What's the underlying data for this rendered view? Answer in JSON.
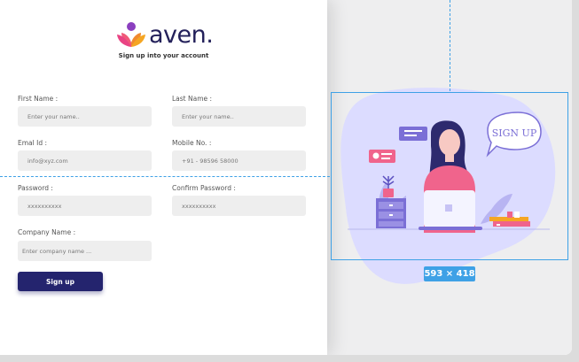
{
  "brand": {
    "name": "aven.",
    "tagline": "Sign up into your account"
  },
  "form": {
    "first_name": {
      "label": "First Name :",
      "placeholder": "Enter your name.."
    },
    "last_name": {
      "label": "Last Name :",
      "placeholder": "Enter your name.."
    },
    "email": {
      "label": "Emal Id :",
      "placeholder": "info@xyz.com"
    },
    "mobile": {
      "label": "Mobile No. :",
      "placeholder": "+91 - 98596 58000"
    },
    "password": {
      "label": "Password :",
      "placeholder": "xxxxxxxxxx"
    },
    "confirm_password": {
      "label": "Confirm Password :",
      "placeholder": "xxxxxxxxxx"
    },
    "company": {
      "label": "Company Name :",
      "placeholder": "Enter company name ..."
    },
    "submit_label": "Sign up"
  },
  "illustration": {
    "bubble_text": "SIGN UP"
  },
  "selection": {
    "dimensions": "593 × 418"
  },
  "colors": {
    "primary": "#24246e",
    "accent_pink": "#f0648c",
    "guide_blue": "#3ea1e6",
    "blob": "#dcdcff"
  }
}
